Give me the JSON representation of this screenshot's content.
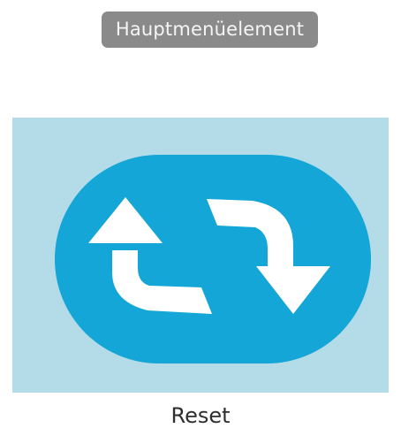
{
  "header": {
    "badge_label": "Hauptmenüelement"
  },
  "tile": {
    "icon": "refresh-arrows-icon",
    "caption": "Reset"
  },
  "colors": {
    "badge_bg": "#8a8a8a",
    "badge_text": "#f5f5f5",
    "panel_bg": "#b3dbe8",
    "pill_bg": "#13a6d6",
    "arrow_fill": "#ffffff",
    "caption_text": "#2e2e2e"
  }
}
